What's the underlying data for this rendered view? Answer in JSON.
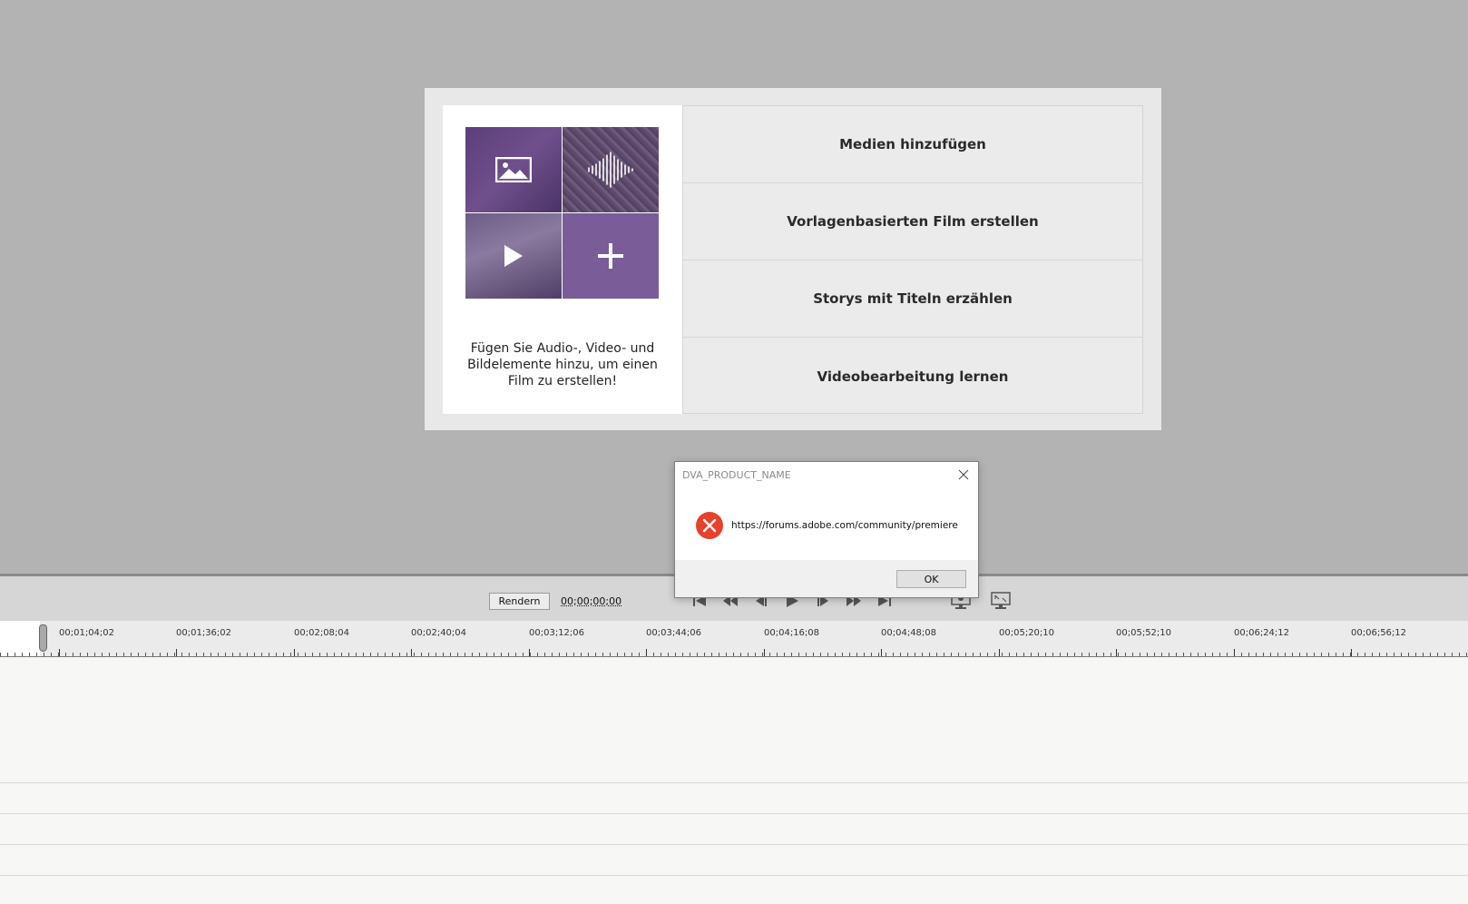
{
  "welcome": {
    "caption": "Fügen Sie Audio-, Video- und Bildelemente hinzu, um einen Film zu erstellen!",
    "options": [
      {
        "label": "Medien hinzufügen"
      },
      {
        "label": "Vorlagenbasierten Film erstellen"
      },
      {
        "label": "Storys mit Titeln erzählen"
      },
      {
        "label": "Videobearbeitung lernen"
      }
    ],
    "tiles": [
      "image-icon",
      "audio-waveform-icon",
      "play-icon",
      "plus-icon"
    ],
    "accent_color": "#7a5c98"
  },
  "controls": {
    "render_label": "Rendern",
    "timecode": "00;00;00;00",
    "transport": [
      "go-to-start-icon",
      "step-back-icon",
      "frame-back-icon",
      "play-icon",
      "frame-forward-icon",
      "step-forward-icon",
      "go-to-end-icon"
    ]
  },
  "ruler": {
    "labels": [
      "00;01;04;02",
      "00;01;36;02",
      "00;02;08;04",
      "00;02;40;04",
      "00;03;12;06",
      "00;03;44;06",
      "00;04;16;08",
      "00;04;48;08",
      "00;05;20;10",
      "00;05;52;10",
      "00;06;24;12",
      "00;06;56;12"
    ]
  },
  "dialog": {
    "title": "DVA_PRODUCT_NAME",
    "message": "https://forums.adobe.com/community/premiere",
    "ok_label": "OK",
    "icon": "error-icon",
    "error_color": "#e5412d"
  }
}
